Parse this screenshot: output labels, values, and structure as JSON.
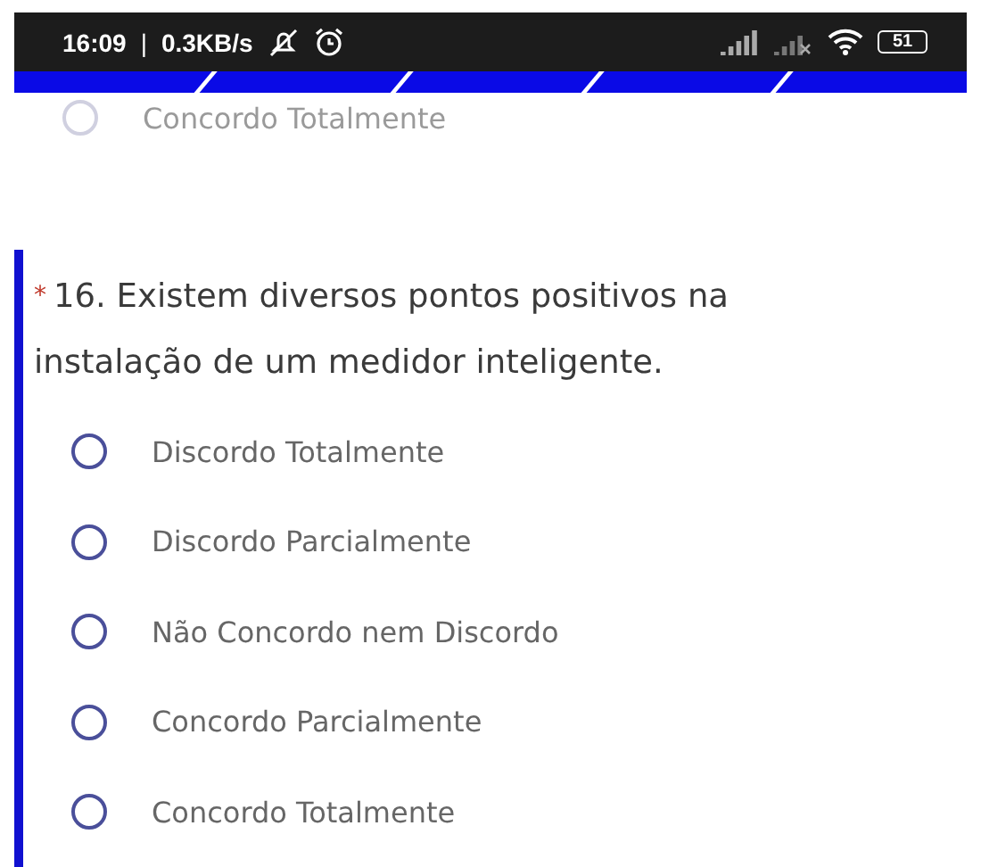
{
  "status_bar": {
    "time": "16:09",
    "separator": "|",
    "speed": "0.3KB/s",
    "battery": "51"
  },
  "previous_question": {
    "options": [
      {
        "label": "Concordo Totalmente",
        "selected": false
      }
    ]
  },
  "question": {
    "required_mark": "*",
    "text": "16. Existem diversos pontos positivos na instalação de um medidor inteligente.",
    "options": [
      {
        "label": "Discordo Totalmente",
        "selected": false
      },
      {
        "label": "Discordo Parcialmente",
        "selected": false
      },
      {
        "label": "Não Concordo nem Discordo",
        "selected": false
      },
      {
        "label": "Concordo Parcialmente",
        "selected": false
      },
      {
        "label": "Concordo Totalmente",
        "selected": false
      }
    ]
  }
}
